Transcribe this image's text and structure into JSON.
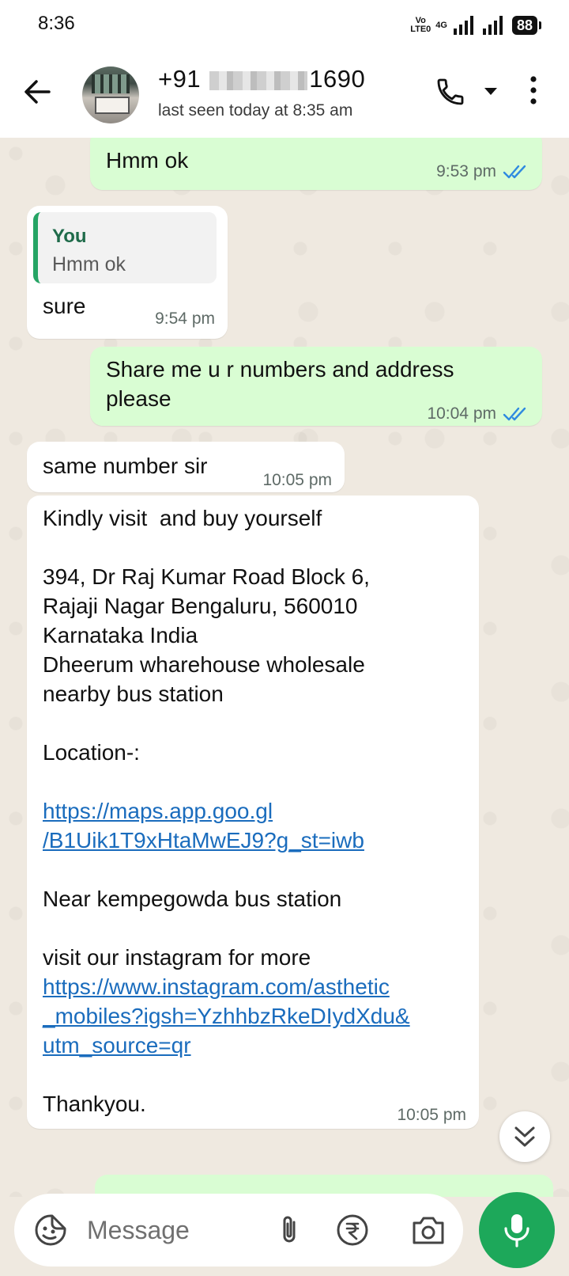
{
  "status_bar": {
    "time": "8:36",
    "volte_top": "Vo",
    "volte_bottom": "LTE0",
    "network": "4G",
    "battery": "88"
  },
  "header": {
    "contact_prefix": "+91",
    "contact_suffix": "1690",
    "last_seen": "last seen today at 8:35 am",
    "icons": [
      "back-arrow-icon",
      "phone-icon",
      "dropdown-icon",
      "more-vert-icon"
    ]
  },
  "messages": [
    {
      "direction": "out",
      "text": "Hmm ok",
      "time": "9:53 pm",
      "read": true
    },
    {
      "direction": "in",
      "reply_to": {
        "author": "You",
        "text": "Hmm ok"
      },
      "text": "sure",
      "time": "9:54 pm"
    },
    {
      "direction": "out",
      "text": "Share me u r numbers and address\nplease",
      "time": "10:04 pm",
      "read": true
    },
    {
      "direction": "in",
      "text": "same number sir",
      "time": "10:05 pm"
    },
    {
      "direction": "in",
      "time": "10:05 pm",
      "intro": "Kindly visit  and buy yourself",
      "address": "394, Dr Raj Kumar Road Block 6,\nRajaji Nagar Bengaluru, 560010\nKarnataka India\nDheerum wharehouse wholesale\nnearby bus station",
      "location_label": "Location-:",
      "maps_link": "https://maps.app.goo.gl\n/B1Uik1T9xHtaMwEJ9?g_st=iwb",
      "near_text": "Near kempegowda bus station",
      "insta_text": "visit our instagram for more",
      "insta_link": "https://www.instagram.com/asthetic\n_mobiles?igsh=YzhhbzRkeDIydXdu&\nutm_source=qr",
      "closing": "Thankyou."
    }
  ],
  "composer": {
    "placeholder": "Message"
  },
  "colors": {
    "outgoing_bubble": "#d9fdd3",
    "incoming_bubble": "#ffffff",
    "chat_background": "#efe9e0",
    "accent": "#1da85a",
    "link": "#1a6cbd",
    "read_ticks": "#2f8ae0"
  }
}
